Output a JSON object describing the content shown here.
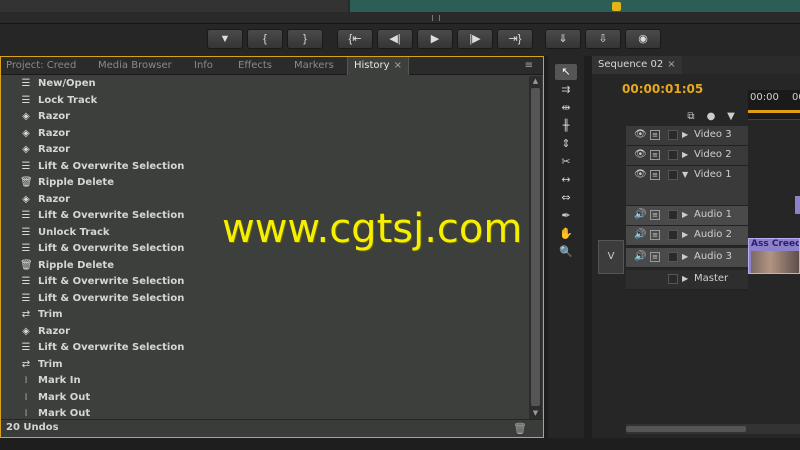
{
  "transport": {
    "buttons": [
      {
        "icon": "marker-icon",
        "glyph": "▼"
      },
      {
        "icon": "mark-in-icon",
        "glyph": "{"
      },
      {
        "icon": "mark-out-icon",
        "glyph": "}"
      },
      {
        "icon": "go-to-in-icon",
        "glyph": "{⇤"
      },
      {
        "icon": "step-back-icon",
        "glyph": "◀|"
      },
      {
        "icon": "play-icon",
        "glyph": "▶"
      },
      {
        "icon": "step-forward-icon",
        "glyph": "|▶"
      },
      {
        "icon": "go-to-out-icon",
        "glyph": "⇥}"
      },
      {
        "icon": "insert-icon",
        "glyph": "⇓"
      },
      {
        "icon": "overwrite-icon",
        "glyph": "⇩"
      },
      {
        "icon": "export-frame-icon",
        "glyph": "◉"
      }
    ]
  },
  "left_panel": {
    "tabs": [
      {
        "label": "Project: Creed",
        "active": false
      },
      {
        "label": "Media Browser",
        "active": false
      },
      {
        "label": "Info",
        "active": false
      },
      {
        "label": "Effects",
        "active": false
      },
      {
        "label": "Markers",
        "active": false
      },
      {
        "label": "History",
        "active": true
      }
    ],
    "tab_close": "×",
    "menu_glyph": "≡",
    "history": [
      {
        "label": "New/Open",
        "icon": "list-icon"
      },
      {
        "label": "Lock Track",
        "icon": "list-icon"
      },
      {
        "label": "Razor",
        "icon": "razor-icon"
      },
      {
        "label": "Razor",
        "icon": "razor-icon"
      },
      {
        "label": "Razor",
        "icon": "razor-icon"
      },
      {
        "label": "Lift & Overwrite Selection",
        "icon": "list-icon"
      },
      {
        "label": "Ripple Delete",
        "icon": "trash-icon"
      },
      {
        "label": "Razor",
        "icon": "razor-icon"
      },
      {
        "label": "Lift & Overwrite Selection",
        "icon": "list-icon"
      },
      {
        "label": "Unlock Track",
        "icon": "list-icon"
      },
      {
        "label": "Lift & Overwrite Selection",
        "icon": "list-icon"
      },
      {
        "label": "Ripple Delete",
        "icon": "trash-icon"
      },
      {
        "label": "Lift & Overwrite Selection",
        "icon": "list-icon"
      },
      {
        "label": "Lift & Overwrite Selection",
        "icon": "list-icon"
      },
      {
        "label": "Trim",
        "icon": "trim-icon"
      },
      {
        "label": "Razor",
        "icon": "razor-icon"
      },
      {
        "label": "Lift & Overwrite Selection",
        "icon": "list-icon"
      },
      {
        "label": "Trim",
        "icon": "trim-icon"
      },
      {
        "label": "Mark In",
        "icon": "mark-icon"
      },
      {
        "label": "Mark Out",
        "icon": "mark-icon"
      },
      {
        "label": "Mark Out",
        "icon": "mark-icon"
      }
    ],
    "status": "20 Undos"
  },
  "tools": [
    {
      "name": "selection-tool",
      "glyph": "↖",
      "active": true
    },
    {
      "name": "track-select-tool",
      "glyph": "⇉"
    },
    {
      "name": "ripple-edit-tool",
      "glyph": "⇹"
    },
    {
      "name": "rolling-edit-tool",
      "glyph": "╫"
    },
    {
      "name": "rate-stretch-tool",
      "glyph": "⇕"
    },
    {
      "name": "razor-tool",
      "glyph": "✂"
    },
    {
      "name": "slip-tool",
      "glyph": "↔"
    },
    {
      "name": "slide-tool",
      "glyph": "⇔"
    },
    {
      "name": "pen-tool",
      "glyph": "✒"
    },
    {
      "name": "hand-tool",
      "glyph": "✋"
    },
    {
      "name": "zoom-tool",
      "glyph": "🔍"
    }
  ],
  "sequence": {
    "tab_label": "Sequence 02",
    "timecode": "00:00:01:05",
    "ruler_ticks": [
      "00:00",
      "00"
    ],
    "source_track": "V",
    "tracks": [
      {
        "name": "Video 3",
        "kind": "video"
      },
      {
        "name": "Video 2",
        "kind": "video"
      },
      {
        "name": "Video 1",
        "kind": "video"
      },
      {
        "name": "Audio 1",
        "kind": "audio"
      },
      {
        "name": "Audio 2",
        "kind": "audio"
      },
      {
        "name": "Audio 3",
        "kind": "audio"
      },
      {
        "name": "Master",
        "kind": "master"
      }
    ],
    "clip_name": "Ass Creed"
  },
  "watermark": "www.cgtsj.com",
  "colors": {
    "accent": "#d9a21b",
    "timecode": "#e7a91f",
    "clip": "#8d82c9",
    "watermark": "#f6f000"
  }
}
